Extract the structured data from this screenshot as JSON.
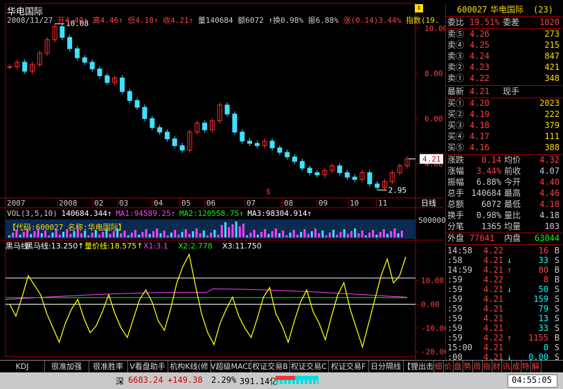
{
  "title": "华电国际",
  "info_line": [
    {
      "text": "2008/11/27",
      "color": "#ccc"
    },
    {
      "text": "开4.40↑",
      "color": "#ff4040"
    },
    {
      "text": "高4.46↑",
      "color": "#ff4040"
    },
    {
      "text": "低4.18↑",
      "color": "#ff4040"
    },
    {
      "text": "收4.21↑",
      "color": "#ff4040"
    },
    {
      "text": "量140684",
      "color": "#ccc"
    },
    {
      "text": "额6072",
      "color": "#ccc"
    },
    {
      "text": "↑换0.98%",
      "color": "#ccc"
    },
    {
      "text": "振6.88%",
      "color": "#ccc"
    },
    {
      "text": "涨(0.14)3.44%",
      "color": "#ff4040"
    },
    {
      "text": "指数(19.",
      "color": "#ffdd00"
    }
  ],
  "price_axis_labels": [
    "10.00",
    "8.00",
    "6.00",
    "4.00"
  ],
  "current_price_tag": "4.21",
  "high_label": "10.08",
  "low_label": "2.95",
  "x_axis_labels": [
    "2007",
    "2008",
    "02",
    "03",
    "04",
    "05",
    "06",
    "07",
    "08",
    "09",
    "10",
    "11"
  ],
  "period_button": "日线",
  "vol_line": [
    {
      "text": "VOL(3,5,10)",
      "color": "#ccc"
    },
    {
      "text": "140684.344↑",
      "color": "#fff"
    },
    {
      "text": "MA1:94589.25↑",
      "color": "#ff40ff"
    },
    {
      "text": "MA2:120558.75↑",
      "color": "#00ff00"
    },
    {
      "text": "MA3:98304.914↑",
      "color": "#fff"
    }
  ],
  "vol_overlay_text": "【代码:600027 名称:华电国际】",
  "vol_axis_label": "500000",
  "indicator_line": [
    {
      "text": "黑马线",
      "color": "#fff"
    },
    {
      "text": "黑马线:13.250↑",
      "color": "#fff"
    },
    {
      "text": "量价线:18.575↑",
      "color": "#ffff00"
    },
    {
      "text": "X1:3.1",
      "color": "#ff40ff"
    },
    {
      "text": "X2:2.778",
      "color": "#00ff00"
    },
    {
      "text": "X3:11.750",
      "color": "#fff"
    }
  ],
  "indicator_axis_labels": [
    "10.00",
    "0.00",
    "-10.00",
    "-20.00"
  ],
  "chart_data": {
    "type": "line",
    "title": "华电国际",
    "price_range": [
      2.95,
      10.08
    ],
    "ylim_price": [
      2.6,
      10.4
    ],
    "price_series_approx": [
      8.3,
      8.5,
      8.1,
      8.4,
      8.9,
      9.5,
      10.08,
      9.6,
      9.1,
      8.7,
      8.5,
      8.2,
      7.9,
      7.6,
      7.8,
      7.2,
      6.8,
      6.5,
      6.0,
      5.6,
      5.4,
      5.1,
      4.8,
      4.6,
      5.4,
      5.8,
      5.5,
      5.9,
      6.6,
      6.2,
      5.4,
      5.0,
      4.9,
      4.8,
      5.0,
      4.7,
      4.5,
      4.3,
      4.1,
      3.8,
      3.6,
      3.5,
      3.7,
      3.9,
      3.6,
      3.4,
      3.3,
      3.6,
      3.1,
      2.95,
      3.2,
      3.6,
      3.9,
      4.21
    ],
    "vol_ylim": [
      0,
      500000
    ],
    "indicator_ylim": [
      -22,
      22
    ],
    "indicator_hlines": [
      11,
      2.78,
      0,
      -20
    ],
    "black_horse_series_approx": [
      0,
      -5,
      3,
      12,
      8,
      4,
      -4,
      -10,
      -16,
      -8,
      -2,
      2,
      -6,
      -12,
      -9,
      -3,
      4,
      -4,
      -10,
      -14,
      -6,
      2,
      6,
      1,
      -7,
      -11,
      -2,
      9,
      16,
      21,
      8,
      -4,
      -12,
      -17,
      -8,
      -2,
      3,
      -5,
      -10,
      -14,
      -6,
      3,
      7,
      -4,
      -9,
      -16,
      -7,
      1,
      6,
      -3,
      -8,
      -15,
      -5,
      4,
      9,
      -2,
      -10,
      -18,
      -8,
      2,
      12,
      19,
      9,
      12,
      20
    ]
  },
  "quote": {
    "code": "600027",
    "name": "华电国际",
    "count": "(23)",
    "weibi_label": "委比",
    "weibi_value": "19.51%",
    "weicha_label": "委差",
    "weicha_value": "1020",
    "sells": [
      {
        "label": "卖⑤",
        "price": "4.26",
        "vol": "273"
      },
      {
        "label": "卖④",
        "price": "4.25",
        "vol": "215"
      },
      {
        "label": "卖③",
        "price": "4.24",
        "vol": "847"
      },
      {
        "label": "卖②",
        "price": "4.23",
        "vol": "421"
      },
      {
        "label": "卖①",
        "price": "4.22",
        "vol": "348"
      }
    ],
    "latest_label": "最新",
    "latest_price": "4.21",
    "latest_tag": "现手",
    "buys": [
      {
        "label": "买①",
        "price": "4.20",
        "vol": "2023"
      },
      {
        "label": "买②",
        "price": "4.19",
        "vol": "222"
      },
      {
        "label": "买③",
        "price": "4.18",
        "vol": "379"
      },
      {
        "label": "买④",
        "price": "4.17",
        "vol": "111"
      },
      {
        "label": "买⑤",
        "price": "4.16",
        "vol": "388"
      }
    ],
    "stats": [
      {
        "l1": "涨跌",
        "v1": "0.14",
        "c1": "#ff4040",
        "l2": "均价",
        "v2": "4.32",
        "c2": "#ff4040"
      },
      {
        "l1": "涨幅",
        "v1": "3.44%",
        "c1": "#ff4040",
        "l2": "前收",
        "v2": "4.07",
        "c2": "#ccc"
      },
      {
        "l1": "振幅",
        "v1": "6.88%",
        "c1": "#ccc",
        "l2": "今开",
        "v2": "4.40",
        "c2": "#ff4040"
      },
      {
        "l1": "总手",
        "v1": "140684",
        "c1": "#ccc",
        "l2": "最高",
        "v2": "4.46",
        "c2": "#ff4040"
      },
      {
        "l1": "总额",
        "v1": "6072",
        "c1": "#ccc",
        "l2": "最低",
        "v2": "4.18",
        "c2": "#ff4040"
      },
      {
        "l1": "换手",
        "v1": "0.98%",
        "c1": "#ccc",
        "l2": "量比",
        "v2": "4.18",
        "c2": "#ccc"
      },
      {
        "l1": "分笔",
        "v1": "1365",
        "c1": "#ccc",
        "l2": "均量",
        "v2": "103",
        "c2": "#ccc"
      }
    ],
    "outer_label": "外盘",
    "outer_value": "77641",
    "inner_label": "内盘",
    "inner_value": "63044",
    "ticks": [
      {
        "time": "14:58",
        "price": "4.22",
        "arrow": "",
        "vol": "16",
        "bs": "B",
        "vc": "#ff4040"
      },
      {
        "time": ":58",
        "price": "4.21",
        "arrow": "↓",
        "vol": "33",
        "bs": "S",
        "vc": "#00ffff"
      },
      {
        "time": "14:59",
        "price": "4.21",
        "arrow": "↑",
        "vol": "80",
        "bs": "B",
        "vc": "#ff4040"
      },
      {
        "time": ":59",
        "price": "4.22",
        "arrow": "",
        "vol": "8",
        "bs": "B",
        "vc": "#ff4040"
      },
      {
        "time": ":59",
        "price": "4.21",
        "arrow": "↓",
        "vol": "50",
        "bs": "S",
        "vc": "#00ffff"
      },
      {
        "time": ":59",
        "price": "4.21",
        "arrow": "",
        "vol": "159",
        "bs": "S",
        "vc": "#00ffff"
      },
      {
        "time": ":59",
        "price": "4.21",
        "arrow": "",
        "vol": "79",
        "bs": "S",
        "vc": "#00ffff"
      },
      {
        "time": ":59",
        "price": "4.21",
        "arrow": "",
        "vol": "13",
        "bs": "S",
        "vc": "#00ffff"
      },
      {
        "time": ":59",
        "price": "4.21",
        "arrow": "",
        "vol": "33",
        "bs": "S",
        "vc": "#00ffff"
      },
      {
        "time": ":59",
        "price": "4.22",
        "arrow": "↑",
        "vol": "1155",
        "bs": "B",
        "vc": "#ff4040"
      },
      {
        "time": "15:00",
        "price": "4.21",
        "arrow": "",
        "vol": "0",
        "bs": "S",
        "vc": "#00ffff"
      },
      {
        "time": ":00",
        "price": "4.21",
        "arrow": "↓",
        "vol": "0.00",
        "bs": "S",
        "vc": "#00ffff"
      }
    ]
  },
  "tabs": [
    "KDJ",
    "很准加强",
    "很准胜率",
    "V看盘助手",
    "机构K线(修",
    "V超级MACD",
    "权证交易B",
    "权证交易C",
    "权证交易F",
    "日分隔线",
    "【狸出击】",
    "细",
    "价",
    "盘",
    "势",
    "周",
    "指",
    "财",
    "讯",
    "成",
    "特",
    "解"
  ],
  "status": {
    "market": "深",
    "index": "6683.24",
    "change": "+149.38",
    "pct": "2.29%",
    "amount": "391.14亿",
    "time": "04:55:05"
  }
}
